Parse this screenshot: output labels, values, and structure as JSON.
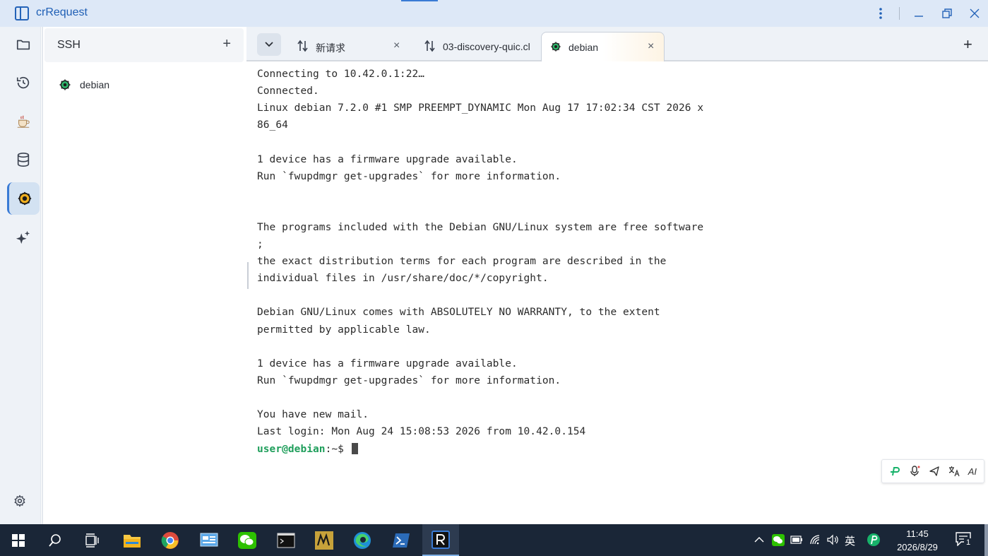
{
  "window": {
    "title": "crRequest",
    "icons": {
      "more": "more-vertical-icon",
      "minimize": "minimize-icon",
      "restore": "restore-icon",
      "close": "close-icon"
    }
  },
  "activity_bar": {
    "items": [
      {
        "name": "collections",
        "icon": "folder-icon"
      },
      {
        "name": "history",
        "icon": "history-icon"
      },
      {
        "name": "java",
        "icon": "coffee-icon"
      },
      {
        "name": "database",
        "icon": "database-icon"
      },
      {
        "name": "ssh",
        "icon": "linux-penguin-icon",
        "active": true
      },
      {
        "name": "ai",
        "icon": "sparkles-icon"
      }
    ],
    "settings_icon": "gear-icon"
  },
  "side_panel": {
    "title": "SSH",
    "add_label": "+",
    "items": [
      {
        "label": "debian",
        "icon": "linux-penguin-icon"
      }
    ]
  },
  "tabs": [
    {
      "label": "新请求",
      "icon": "request-arrows-icon",
      "active": false
    },
    {
      "label": "03-discovery-quic.cl",
      "icon": "request-arrows-icon",
      "active": false
    },
    {
      "label": "debian",
      "icon": "linux-penguin-icon",
      "active": true
    }
  ],
  "tab_close_label": "×",
  "new_tab_label": "+",
  "terminal": {
    "lines": [
      "Connecting to 10.42.0.1:22…",
      "Connected.",
      "Linux debian 7.2.0 #1 SMP PREEMPT_DYNAMIC Mon Aug 17 17:02:34 CST 2026 x",
      "86_64",
      "",
      "1 device has a firmware upgrade available.",
      "Run `fwupdmgr get-upgrades` for more information.",
      "",
      "",
      "The programs included with the Debian GNU/Linux system are free software",
      ";",
      "the exact distribution terms for each program are described in the",
      "individual files in /usr/share/doc/*/copyright.",
      "",
      "Debian GNU/Linux comes with ABSOLUTELY NO WARRANTY, to the extent",
      "permitted by applicable law.",
      "",
      "1 device has a firmware upgrade available.",
      "Run `fwupdmgr get-upgrades` for more information.",
      "",
      "You have new mail.",
      "Last login: Mon Aug 24 15:08:53 2026 from 10.42.0.154"
    ],
    "prompt_user": "user@debian",
    "prompt_suffix": ":~$ ",
    "prompt_color": "#1f9e5b"
  },
  "ime_toolbar": {
    "items": [
      "pinyin-logo-icon",
      "microphone-icon",
      "send-icon",
      "translate-icon",
      "ai-text-icon"
    ],
    "ai_label": "AI"
  },
  "taskbar": {
    "apps": [
      "windows-start-icon",
      "search-icon",
      "task-view-icon",
      "file-explorer-icon",
      "chrome-icon",
      "control-panel-icon",
      "wechat-icon",
      "terminal-icon",
      "m3-app-icon",
      "edge-icon",
      "powershell-icon",
      "crrequest-icon"
    ],
    "tray": {
      "ime_label": "英",
      "time": "11:45",
      "date": "2026/8/29",
      "notification_count": "1"
    }
  },
  "colors": {
    "accent": "#3a7bd5",
    "titlebar_bg": "#dde8f7",
    "taskbar_bg": "#1a2637"
  }
}
